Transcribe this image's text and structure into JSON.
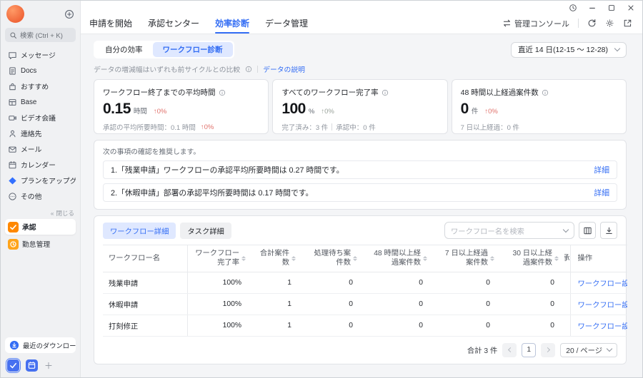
{
  "sidebar": {
    "search_placeholder": "検索 (Ctrl + K)",
    "items": [
      {
        "label": "メッセージ",
        "icon": "message-icon"
      },
      {
        "label": "Docs",
        "icon": "docs-icon"
      },
      {
        "label": "おすすめ",
        "icon": "recommend-icon"
      },
      {
        "label": "Base",
        "icon": "base-icon"
      },
      {
        "label": "ビデオ会議",
        "icon": "video-icon"
      },
      {
        "label": "連絡先",
        "icon": "contacts-icon"
      },
      {
        "label": "メール",
        "icon": "mail-icon"
      },
      {
        "label": "カレンダー",
        "icon": "calendar-icon"
      },
      {
        "label": "プランをアップグレード",
        "icon": "upgrade-icon"
      },
      {
        "label": "その他",
        "icon": "more-icon"
      }
    ],
    "collapse_label": "閉じる",
    "pinned": [
      {
        "label": "承認",
        "icon": "approval-icon",
        "active": true
      },
      {
        "label": "勤怠管理",
        "icon": "attendance-icon",
        "active": false
      }
    ],
    "downloads_label": "最近のダウンロード"
  },
  "topnav": {
    "tabs": [
      "申請を開始",
      "承認センター",
      "効率診断",
      "データ管理"
    ],
    "active_tab": "効率診断",
    "admin_console": "管理コンソール"
  },
  "filters": {
    "subtabs": [
      "自分の効率",
      "ワークフロー診断"
    ],
    "active_subtab": "ワークフロー診断",
    "date_range": "直近 14 日(12-15 ～ 12-28)",
    "note": "データの増減幅はいずれも前サイクルとの比較",
    "data_link": "データの説明"
  },
  "stats": [
    {
      "title": "ワークフロー終了までの平均時間",
      "value": "0.15",
      "unit": "時間",
      "delta": "0%",
      "sub": "承認の平均所要時間：0.1 時間",
      "sub_delta": "0%"
    },
    {
      "title": "すべてのワークフロー完了率",
      "value": "100",
      "unit": "%",
      "delta": "0%",
      "sub_left": "完了済み：3 件",
      "sub_right": "承認中：0 件"
    },
    {
      "title": "48 時間以上経過案件数",
      "value": "0",
      "unit": "件",
      "delta": "0%",
      "sub": "7 日以上経過：0 件"
    }
  ],
  "recommendations": {
    "title": "次の事項の確認を推奨します。",
    "items": [
      {
        "text": "1.「残業申請」ワークフローの承認平均所要時間は 0.27 時間です。",
        "link": "詳細"
      },
      {
        "text": "2.「休暇申請」部署の承認平均所要時間は 0.17 時間です。",
        "link": "詳細"
      }
    ]
  },
  "table": {
    "view_tabs": [
      "ワークフロー詳細",
      "タスク詳細"
    ],
    "active_view": "ワークフロー詳細",
    "search_placeholder": "ワークフロー名を検索",
    "columns": [
      {
        "label": "ワークフロー名",
        "sortable": false
      },
      {
        "label": "ワークフロー完了率",
        "sortable": true
      },
      {
        "label": "合計案件数",
        "sortable": true
      },
      {
        "label": "処理待ち案件数",
        "sortable": true
      },
      {
        "label": "48 時間以上経過案件数",
        "sortable": true
      },
      {
        "label": "7 日以上経過案件数",
        "sortable": true
      },
      {
        "label": "30 日以上経過案件数",
        "sortable": true
      },
      {
        "label": "承",
        "clipped": true
      },
      {
        "label": "操作",
        "action": true
      }
    ],
    "rows": [
      {
        "cells": [
          "残業申請",
          "100%",
          "1",
          "0",
          "0",
          "0",
          "0"
        ],
        "action": "ワークフロー設定を"
      },
      {
        "cells": [
          "休暇申請",
          "100%",
          "1",
          "0",
          "0",
          "0",
          "0"
        ],
        "action": "ワークフロー設定を"
      },
      {
        "cells": [
          "打刻修正",
          "100%",
          "1",
          "0",
          "0",
          "0",
          "0"
        ],
        "action": "ワークフロー設定を"
      }
    ],
    "pagination": {
      "total": "合計 3 件",
      "current_page": "1",
      "page_size": "20 / ページ"
    }
  },
  "colors": {
    "accent_blue": "#336df4",
    "pill_blue_bg": "#dfe8ff",
    "delta_up_red": "#e0716b",
    "approval_orange": "#ff8800",
    "sidebar_bg": "#f0f1f3",
    "content_bg": "#f4f5f7"
  }
}
